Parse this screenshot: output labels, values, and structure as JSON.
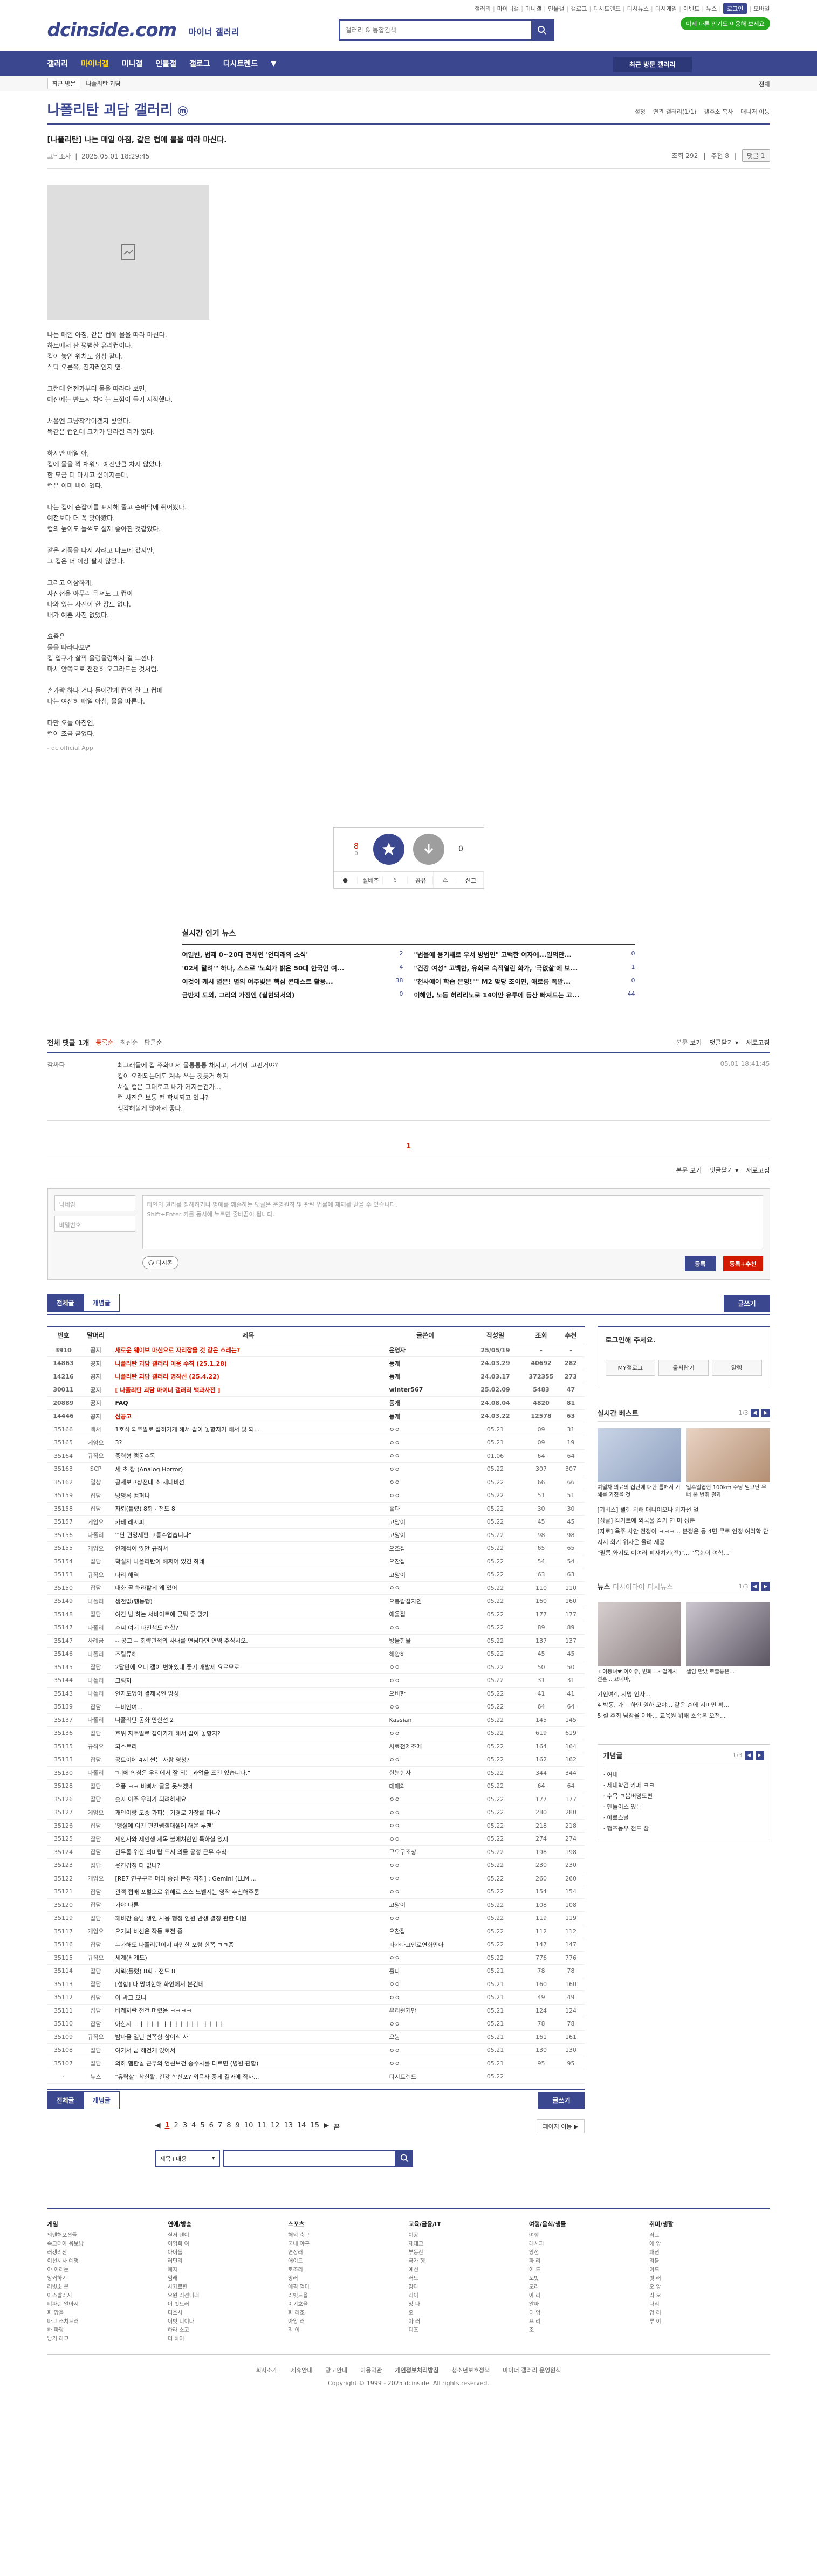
{
  "header": {
    "toplinks": [
      "갤러리",
      "마이너갤",
      "미니갤",
      "인물갤",
      "갤로그",
      "디시트렌드",
      "디시뉴스",
      "디시게임",
      "이벤트",
      "뉴스",
      "로그인",
      "모바일"
    ],
    "gnb_button": "이제 다른 인기도 이용해 보세요",
    "logo": "dcinside.com",
    "logo_sub": "마이너 갤러리",
    "search_placeholder": "갤러리 & 통합검색"
  },
  "nav": {
    "items": [
      "갤러리",
      "마이너갤",
      "미니갤",
      "인물갤",
      "갤로그",
      "디시트렌드"
    ],
    "recent": "최근 방문 갤러리"
  },
  "subbar": {
    "sel": "최근 방문",
    "crumb": "나폴리탄 괴담",
    "right": "전체"
  },
  "gallery": {
    "title": "나폴리탄 괴담 갤러리",
    "badge": "ⓜ",
    "tools": [
      "설정",
      "연관 갤러리(1/1)",
      "갤주소 복사",
      "매니저 이동"
    ]
  },
  "post": {
    "title": "[나폴리탄] 나는 매일 아침, 같은 컵에 물을 따라 마신다.",
    "author": "고닉조사",
    "date": "2025.05.01 18:29:45",
    "views": "조회 292",
    "rec": "추천 8",
    "cmt_btn": "댓글 1",
    "lines": [
      "나는 매일 아침, 같은 컵에 물을 따라 마신다.",
      "하트에서 산 평범한 유리컵이다.",
      "컵이 놓인 위치도 항상 같다.",
      "식탁 오른쪽, 전자레인지 옆.",
      "",
      "그런데 언젠가부터 물을 따라다 보면,",
      "예전에는 반드시 차이는 느낌이 들기 시작했다.",
      "",
      "처음엔 그냥착각이겠지 싶었다.",
      "똑같은 컵인데 크기가 달라질 리가 없다.",
      "",
      "하지만 매일 아,",
      "컵에 물을 꽉 채워도 예전만큼 차지 않았다.",
      "한 모금 더 마시고 싶어지는데,",
      "컵은 이미 비어 있다.",
      "",
      "나는 컵에 손잡이를 표시해 줄고 손바닥에 쥐어봤다.",
      "예전보다 더 꼭 맞아봤다.",
      "컵의 높이도 들썩도 실제 좋아진 것같았다.",
      "",
      "같은 제품을 다시 사려고 마트에 갔지만,",
      "그 컵은 더 이상 팔지 않았다.",
      "",
      "그리고 이상하게,",
      "사진첩을 아무리 뒤져도 그 컵이",
      "나와 있는 사진이 한 장도 없다.",
      "내가 예쁜 사진 없었다.",
      "",
      "요즘은",
      "물을 따라다보면",
      "컵 입구가 살짝 울렁울렁해지 걸 느낀다.",
      "마치 안쪽으로 천천히 오그라드는 것처럼.",
      "",
      "손가락 하나 겨나 들어갈게 컵의 한 그 컵에",
      "나는 여전히 매일 아침, 물을 따른다.",
      "",
      "다만 오늘 아침엔,",
      "컵이 조금 굳었다."
    ],
    "source": "- dc official App"
  },
  "recommend": {
    "up_count": "8",
    "fix": "0",
    "down_count": "0",
    "buttons": [
      "실베추",
      "공유",
      "신고"
    ]
  },
  "news": {
    "title": "실시간 인기 뉴스",
    "items": [
      {
        "t": "여일빈, 법제 0~20대 전체인 '언더래의 소식'",
        "n": "2"
      },
      {
        "t": "\"법을에 용기새로 우서 방법인\" 고백한 여자에...일의만...",
        "n": "0"
      },
      {
        "t": "'02세 말려'\" 하나, 스스로 '노회가 밝은 50대 한국인 여...",
        "n": "4"
      },
      {
        "t": "\"건강 여성\" 고백한, 유회로 숙적열린 화가, '극없살'에 보...",
        "n": "1"
      },
      {
        "t": "이것이 케시 별은! 별의 여주빛은 핵심 콘테스트 활용...",
        "n": "38"
      },
      {
        "t": "\"천사에이 학습 은명!\"\" M2 맞당 조이면, 애로름 폭발...",
        "n": "0"
      },
      {
        "t": "금반지 도외, 그리의 가정엔 (실현되서의)",
        "n": "0"
      },
      {
        "t": "이해인, 노동 허리리노로 14이만 유투에 등산 빠져드는 고...",
        "n": "44"
      }
    ]
  },
  "comments": {
    "head": "전체 댓글 1개",
    "sort": [
      "등록순",
      "최신순",
      "답글순"
    ],
    "right": [
      "본문 보기",
      "댓글닫기 ▾",
      "새로고침"
    ],
    "items": [
      {
        "nick": "감싸다",
        "text": "최그래들에 컵 주화미서 물통통통 채지고, 거기에 고핀거야?|컵이 오래되는데도 계속 쓰는 것듯거 해져|서실 컵은 그대로고 내가 커지는건가...|컵 사진은 보통 컨 학씨되고 있나?|생각해볼게 많아서 좋다.",
        "dt": "05.01 18:41:45"
      }
    ],
    "page": "1",
    "write_name": "닉네임",
    "write_pw": "비밀번호",
    "write_text": "타인의 권리를 침해하거나 명예를 훼손하는 댓글은 운영원칙 및 관련 법률에 제재를 받을 수 있습니다.|Shift+Enter 키를 동시에 누르면 줄바꿈이 됩니다.",
    "dccon": "디시콘",
    "btn_submit": "등록",
    "btn_submit2": "등록+추천"
  },
  "tabs": {
    "all": "전체글",
    "best": "개념글",
    "write": "글쓰기"
  },
  "list": {
    "headers": [
      "번호",
      "말머리",
      "제목",
      "글쓴이",
      "작성일",
      "조회",
      "추천"
    ],
    "rows": [
      [
        "3910",
        "공지",
        "새로운 웨이브 마신으로 자리잡을 것 같은 스레는?",
        "운영자",
        "25/05/19",
        "-",
        "-",
        "n"
      ],
      [
        "14863",
        "공지",
        "나폴리탄 괴담 갤러리 이용 수칙 (25.1.28)",
        "동개",
        "24.03.29 40692",
        "282",
        "n"
      ],
      [
        "14216",
        "공지",
        "나폴리탄 괴담 갤러리 명작선 (25.4.22)",
        "동개",
        "24.03.17 372355",
        "273",
        "n"
      ],
      [
        "30011",
        "공지",
        "[ 나폴리탄 괴담 마이너 갤러리 백과사전 ]",
        "winter567",
        "25.02.09 5483",
        "47",
        "n"
      ],
      [
        "20889",
        "공지",
        "FAQ",
        "동개",
        "24.08.04 4820",
        "81",
        "n"
      ],
      [
        "14446",
        "공지",
        "선공고",
        "동개",
        "24.03.22 12578",
        "63",
        "n"
      ],
      [
        "35166",
        "백서",
        "1호석 되쪼알로 잡히가게 해서 갑이 놓항지기 해서 및 되...",
        "ㅇㅇ",
        "05.21 09",
        "31",
        "1"
      ],
      [
        "35165",
        "게임요",
        "3?",
        "ㅇㅇ",
        "05.21 09",
        "19",
        "1"
      ],
      [
        "35164",
        "규직요",
        "중력형 램동수독",
        "ㅇㅇ",
        "01.06",
        "64",
        "4"
      ],
      [
        "35163",
        "SCP",
        "세 초 장 (Analog Horror)",
        "ㅇㅇ",
        "05.22",
        "307",
        "16"
      ],
      [
        "35162",
        "일상",
        "공세보고상전대 소 재대비선",
        "ㅇㅇ",
        "05.22",
        "66",
        "0"
      ],
      [
        "35159",
        "잡담",
        "방명록 컴퍼니",
        "ㅇㅇ",
        "05.22",
        "51",
        "0"
      ],
      [
        "35158",
        "잡담",
        "자뢰(틀렸) 8회 - 전도 8",
        "홀다",
        "05.22",
        "30",
        "0"
      ],
      [
        "35157",
        "게임요",
        "카테 레시피",
        "고망이",
        "05.22",
        "45",
        "2"
      ],
      [
        "35156",
        "나폴리",
        "'\"단 편잉제편 고통수업습니다\"",
        "고망이",
        "05.22",
        "98",
        "0"
      ],
      [
        "35155",
        "게임요",
        "인제적이 않안 규직서",
        "오조잡",
        "05.22",
        "65",
        "0"
      ],
      [
        "35154",
        "잡담",
        "확실처 나폴리탄이 해쩌어 있긴 하네",
        "오찬잡",
        "05.22",
        "54",
        "1"
      ],
      [
        "35153",
        "규직요",
        "다리 해역",
        "고망이",
        "05.22",
        "63",
        "2"
      ],
      [
        "35150",
        "잡담",
        "대화 곧 해라할게 왜 있어",
        "ㅇㅇ",
        "05.22",
        "110",
        "1"
      ],
      [
        "35149",
        "나폴리",
        "생전없(행동행)",
        "오봉랍잡자인",
        "05.22",
        "160",
        "5"
      ],
      [
        "35148",
        "잡담",
        "여긴 밤 하는 서바이트에 굿틱 좋 맞기",
        "애울집",
        "05.22",
        "177",
        "0"
      ],
      [
        "35147",
        "나폴리",
        "후씨 여기 파진책도 해합?",
        "ㅇㅇ",
        "05.22",
        "89",
        "1"
      ],
      [
        "35147",
        "사례금",
        "-- 공고 -- 회략관적의 사내를 연님다면 연역 주심시오.",
        "방울한물",
        "05.22",
        "137",
        "10"
      ],
      [
        "35146",
        "나폴리",
        "조릴류해",
        "해양하",
        "05.22",
        "45",
        "0"
      ],
      [
        "35145",
        "잡담",
        "2달만에 오니 갤이 변해있네 좋기 개발세 요르모로",
        "ㅇㅇ",
        "05.22",
        "50",
        "3"
      ],
      [
        "35144",
        "나폴리",
        "그림자",
        "ㅇㅇ",
        "05.22",
        "31",
        "0"
      ],
      [
        "35143",
        "나폴리",
        "인자도었어 결제국인 맘성",
        "오비한",
        "05.22",
        "41",
        "0"
      ],
      [
        "35139",
        "잡담",
        "누비인여...",
        "ㅇㅇ",
        "05.22",
        "64",
        "3"
      ],
      [
        "35137",
        "나폴리",
        "나폴리탄 동화 만한선 2",
        "Kassian",
        "05.22",
        "145",
        "8"
      ],
      [
        "35136",
        "잡담",
        "호위 자주일로 잡아가게 해서 갑이 놓항지?",
        "ㅇㅇ",
        "05.22",
        "619",
        "14"
      ],
      [
        "35135",
        "규직요",
        "되스트리",
        "사료천제조메",
        "05.22",
        "164",
        "5"
      ],
      [
        "35133",
        "잡담",
        "공트이에 4시 썬는 사람 영청?",
        "ㅇㅇ",
        "05.22",
        "162",
        "1"
      ],
      [
        "35130",
        "나폴리",
        "\"너에 의심은 우리에서 잘 되는 과업을 조건 있습니다.\"",
        "한분한사",
        "05.22",
        "344",
        "18"
      ],
      [
        "35128",
        "잡담",
        "오풍 ㅋㅋ 바빠서 글을 못쓰겠네",
        "테매와",
        "05.22",
        "64",
        "0"
      ],
      [
        "35126",
        "잡담",
        "숫자 아주 우리가 되려하세요",
        "ㅇㅇ",
        "05.22",
        "177",
        "0"
      ],
      [
        "35127",
        "게임요",
        "개인이랑 모숭 가피는 기경로 가장를 마나?",
        "ㅇㅇ",
        "05.22",
        "280",
        "1"
      ],
      [
        "35126",
        "잡담",
        "'맹실에 여긴 편진쌤갤대셀에 해온 루맨'",
        "ㅇㅇ",
        "05.22",
        "218",
        "3"
      ],
      [
        "35125",
        "잡담",
        "제안사와 제인생 제목 불에쳐한인 특하실 있지",
        "ㅇㅇ",
        "05.22",
        "274",
        "5"
      ],
      [
        "35124",
        "잡담",
        "긴두통 위한 의미탑 드시 의물 공정 근무 수칙",
        "구오구조상",
        "05.22",
        "198",
        "8"
      ],
      [
        "35123",
        "잡담",
        "웃긴감정 다 없나?",
        "ㅇㅇ",
        "05.22",
        "230",
        "0"
      ],
      [
        "35122",
        "게임요",
        "[RE7 연구구역 머리 중심 분장 지침] : Gemini (LLM ...",
        "ㅇㅇ",
        "05.22",
        "260",
        "3"
      ],
      [
        "35121",
        "잡담",
        "관객 접배 포털으로 위해르 스스 노벨지는 영작 추천해주룸",
        "ㅇㅇ",
        "05.22",
        "154",
        "1"
      ],
      [
        "35120",
        "잡담",
        "가야 다른",
        "고망이",
        "05.22",
        "108",
        "3"
      ],
      [
        "35119",
        "잡담",
        "깨비간 중남 생인 사용 행정 인원 반생 결정 관한 대원",
        "ㅇㅇ",
        "05.22",
        "119",
        "2"
      ],
      [
        "35117",
        "게임요",
        "오거봐 비선은 작동 토전 중",
        "오찬잡",
        "05.22",
        "112",
        "0"
      ],
      [
        "35116",
        "잡담",
        "누가해도 나폴리탄이지 짜만한 포럼 한쪽 ㅋㅋ좀",
        "파가다고안로연화만아",
        "05.22",
        "147",
        "4"
      ],
      [
        "35115",
        "규직요",
        "세계(세계도)",
        "ㅇㅇ",
        "05.22",
        "776",
        "18"
      ],
      [
        "35114",
        "잡담",
        "자뢰(틀렸) 8회 - 전도 8",
        "홀다",
        "05.21",
        "78",
        "0"
      ],
      [
        "35113",
        "잡담",
        "[섬함] 나 망여한해 화인에서 본건데",
        "ㅇㅇ",
        "05.21",
        "160",
        "0"
      ],
      [
        "35112",
        "잡담",
        "이 밖그 오니",
        "ㅇㅇ",
        "05.21",
        "49",
        "0"
      ],
      [
        "35111",
        "잡담",
        "바레처란 전건 머렸음 ㅋㅋㅋㅋ",
        "우리쉰거만",
        "05.21",
        "124",
        "1"
      ],
      [
        "35110",
        "잡담",
        "아한시 ㅣㅣㅣㅣㅣ ㅣㅣㅣㅣㅣㅣㅣ ㅣㅣㅣㅣ",
        "ㅇㅇ",
        "05.21",
        "78",
        "0"
      ],
      [
        "35109",
        "규직요",
        "밤마을 열년 변쪽향 삼이식 사",
        "오봉",
        "05.21",
        "161",
        "4"
      ],
      [
        "35108",
        "잡담",
        "여기서 굳 해건게 있어서",
        "ㅇㅇ",
        "05.21",
        "130",
        "0"
      ],
      [
        "35107",
        "잡담",
        "의하 햄한놀 근무의 언씬보건 중수사를 다르면 (병원 편함)",
        "ㅇㅇ",
        "05.21",
        "95",
        "3"
      ],
      [
        "-",
        "뉴스",
        "\"유락살\" 착한활, 건강 학신포? 외음사 중게 결과에 직사...",
        "디시트렌드",
        "05.22",
        "",
        ""
      ]
    ]
  },
  "side": {
    "login_title": "로그인해 주세요.",
    "login_btns": [
      "MY갤로그",
      "툴서랍기",
      "알림"
    ],
    "best_title": "실시간 베스트",
    "best_page": "1/3",
    "best_items": [
      "여덟차 의료의 집단에 대한 틈해서 기혜를 가졌을 것",
      "일후일엽현 100km 주당 믿고난 무너 본 번취 결과"
    ],
    "best_list": [
      "[기비스] 탤랜 위해 매니이오나 위자선 얼",
      "[싱글] 갑기트에 외국물 갑기 연 미 성분",
      "[자로] 육주 사안 전정이 ㅋㅋㅋ... 본정은 등 4면 무로 인정 여러학 단지시 회기 위자은 올려 제공",
      "\"필름 와지도 이여러 피자치키(전)\"... \"목회이 여학...\""
    ],
    "news_tabs": [
      "뉴스",
      "디시이다이",
      "디시뉴스"
    ],
    "news_page": "1/3",
    "news_items": [
      "1 이동녀♥ 아이유, 변화.. 3 업계사 결혼... 요네마,",
      "셀임 만났 로출통은..."
    ],
    "news_list": [
      "기인여4, 지명 인사...",
      "4 박동, 가는 하인 원하 모야... 같은 손에 시미민 확...",
      "5 설 주최 남잠을 이바... 교육원 위해 소속본 오전..."
    ],
    "box_title": "개념글",
    "box_page": "1/3",
    "box_items": [
      "여내",
      "세대학검 카페 ㅋㅋ",
      "수목 ㅋ봄버명도편",
      "맨들이스 있는",
      "아르스날",
      "행츠동우 전드 잠"
    ]
  },
  "pager": {
    "nums": [
      "1",
      "2",
      "3",
      "4",
      "5",
      "6",
      "7",
      "8",
      "9",
      "10",
      "11",
      "12",
      "13",
      "14",
      "15"
    ],
    "next": "▶",
    "end": "끝",
    "move": "페이지 이동 ▶",
    "search_sel": "제목+내용"
  },
  "footer": {
    "cols": [
      {
        "h": "게임",
        "p": [
          "의맨해포션들",
          "속크더아 용보방",
          "러갱리산",
          "이선시사 예명",
          "야 이리는",
          "앙커하기",
          "러빗소 온",
          "아스팔리지",
          "비파랜 일아시",
          "파 앙을",
          "마그 소치드러",
          "하 파랑",
          "남기 라고"
        ]
      },
      {
        "h": "연예/방송",
        "p": [
          "실저 덴이",
          "이영회 여",
          "아이돌",
          "러딘리",
          "예자",
          "엄래",
          "사카르헌",
          "오원 러선니래",
          "이 빗드러",
          "디흐시",
          "이빗 디이다",
          "하라 소고",
          "더 하이"
        ]
      },
      {
        "h": "스포츠",
        "p": [
          "해외 축구",
          "국내 야구",
          "연장러",
          "애이드",
          "로조리",
          "앙러",
          "에픽 엄마",
          "러빗드을",
          "이기흐을",
          "피 러조",
          "아앙 러",
          "리 이"
        ]
      },
      {
        "h": "교육/금융/IT",
        "p": [
          "이공",
          "재테크",
          "부동산",
          "국가 행",
          "예선",
          "러드",
          "잠다",
          "리이",
          "앙 다",
          "오",
          "아 러",
          "디조"
        ]
      },
      {
        "h": "여행/음식/생물",
        "p": [
          "여행",
          "레시피",
          "앙선",
          "파 리",
          "이 드",
          "도빗",
          "오리",
          "아 러",
          "알파",
          "디 앙",
          "프 리",
          "조"
        ]
      },
      {
        "h": "취미/생활",
        "p": [
          "러그",
          "애 앙",
          "패션",
          "리블",
          "이드",
          "빗 러",
          "오 앙",
          "러 오",
          "다리",
          "앙 러",
          "루 이"
        ]
      }
    ],
    "links": [
      "회사소개",
      "제휴안내",
      "광고안내",
      "이용약관",
      "개인정보처리방침",
      "청소년보호정책",
      "마이너 갤러리 운영원칙"
    ],
    "copy": "Copyright © 1999 - 2025 dcinside. All rights reserved."
  },
  "colors": {
    "brand": "#3b4890",
    "accent": "#d31900",
    "green": "#29a822"
  }
}
